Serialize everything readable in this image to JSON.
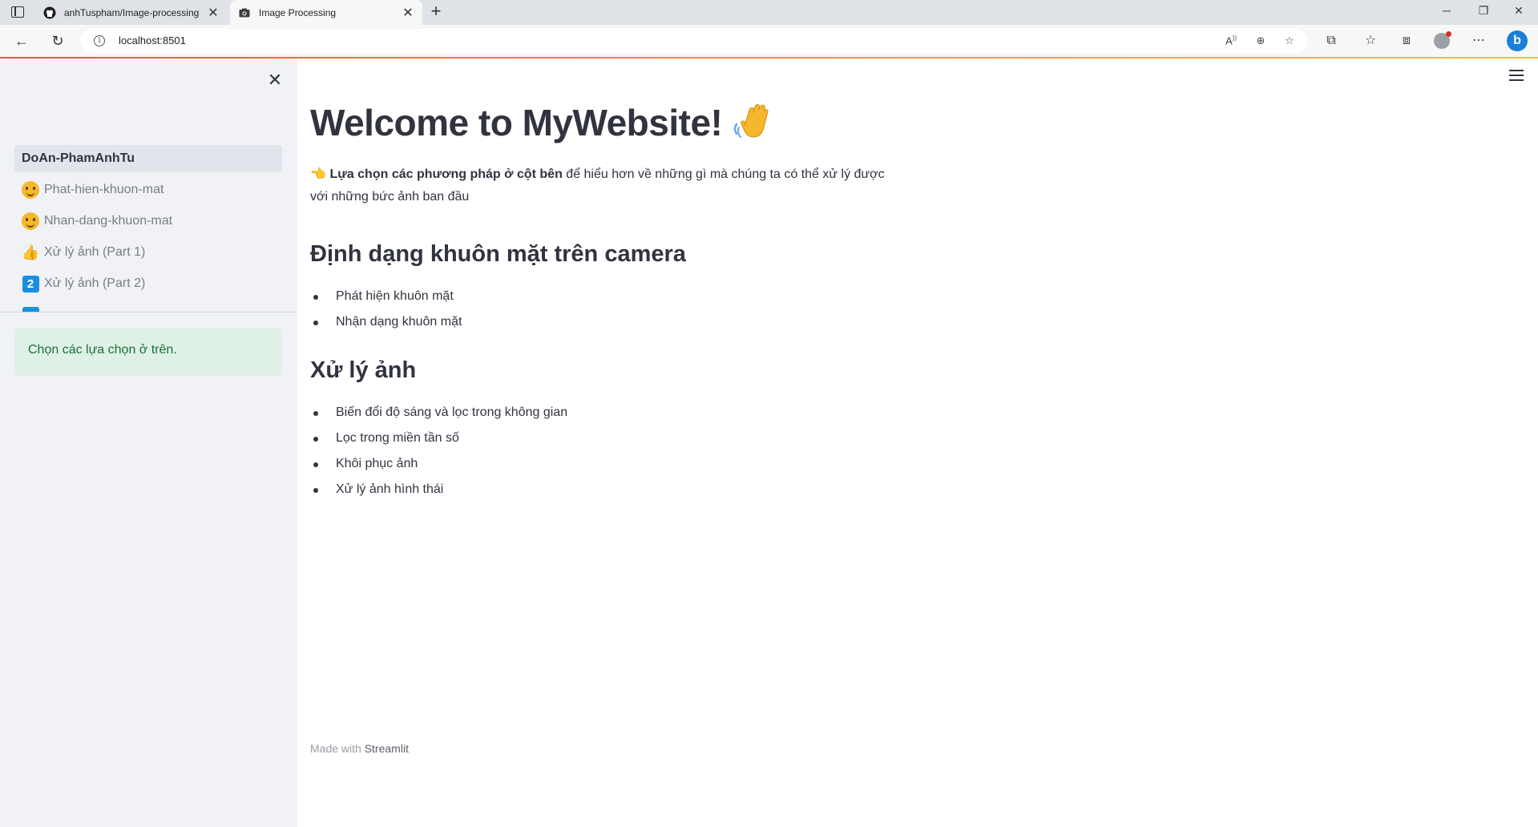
{
  "browser": {
    "tabs": [
      {
        "title": "anhTuspham/Image-processing",
        "favicon": "github-icon",
        "active": false
      },
      {
        "title": "Image Processing",
        "favicon": "camera-icon",
        "active": true
      }
    ],
    "url": "localhost:8501"
  },
  "sidebar": {
    "nav_items": [
      {
        "label": "DoAn-PhamAnhTu",
        "emoji": "",
        "active": true
      },
      {
        "label": "Phat-hien-khuon-mat",
        "emoji": "slightly-smiling-face",
        "active": false
      },
      {
        "label": "Nhan-dang-khuon-mat",
        "emoji": "smiling-face",
        "active": false
      },
      {
        "label": "Xử lý ảnh (Part 1)",
        "emoji": "thumbs-up",
        "active": false
      },
      {
        "label": "Xử lý ảnh (Part 2)",
        "emoji": "keycap-2",
        "badge": "2",
        "active": false
      }
    ],
    "info_message": "Chọn các lựa chọn ở trên."
  },
  "main": {
    "title": "Welcome to MyWebsite!",
    "intro_bold": "Lựa chọn các phương pháp ở cột bên",
    "intro_rest": " để hiểu hơn về những gì mà chúng ta có thể xử lý được với những bức ảnh ban đầu",
    "section1_title": "Định dạng khuôn mặt trên camera",
    "section1_items": [
      "Phát hiện khuôn mặt",
      "Nhận dạng khuôn mặt"
    ],
    "section2_title": "Xử lý ảnh",
    "section2_items": [
      "Biến đổi độ sáng và lọc trong không gian",
      "Lọc trong miền tần số",
      "Khôi phục ảnh",
      "Xử lý ảnh hình thái"
    ]
  },
  "footer": {
    "prefix": "Made with ",
    "brand": "Streamlit"
  },
  "colors": {
    "accent_start": "#ff4b4b",
    "accent_end": "#ffbd45",
    "sidebar_bg": "#f0f2f6",
    "info_bg": "#dff0e6",
    "info_text": "#177233",
    "text": "#31333f"
  }
}
